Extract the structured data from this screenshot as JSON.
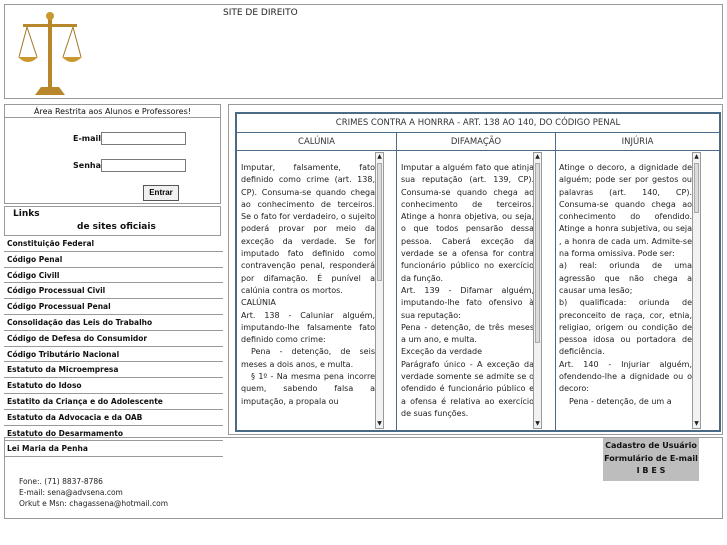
{
  "header": {
    "title": "SITE DE DIREITO"
  },
  "login": {
    "title": "Área Restrita aos Alunos e Professores!",
    "email_label": "E-mail",
    "password_label": "Senha",
    "submit_label": "Entrar"
  },
  "links": {
    "title": "Links",
    "subtitle": "de sites oficiais",
    "items": [
      "Constituição Federal",
      "Código Penal",
      "Código Civill",
      "Código Processual Civil",
      "Código Processual Penal",
      "Consolidação das Leis do Trabalho",
      "Código de Defesa do Consumidor",
      "Código Tributário Nacional",
      "Estatuto da Microempresa",
      "Estatuto do Idoso",
      "Estatito da Criança e do Adolescente",
      "Estatuto da Advocacia e da OAB",
      "Estatuto do Desarmamento",
      "Lei Maria da Penha"
    ]
  },
  "crimes": {
    "title": "CRIMES CONTRA A HONRRA - ART. 138 AO 140, DO CÓDIGO PENAL",
    "columns": [
      {
        "heading": "CALÚNIA",
        "paragraphs": [
          "Imputar, falsamente, fato definido como crime (art. 138, CP). Consuma-se quando chega ao conhecimento de terceiros. Se o fato for verdadeiro, o sujeito poderá provar por meio da exceção da verdade. Se for imputado fato definido como contravenção penal, responderá por difamação. É punível a calúnia contra os mortos.",
          "CALÚNIA",
          "Art. 138 - Caluniar alguém, imputando-lhe falsamente fato definido como crime:",
          "Pena - detenção, de seis meses a dois anos, e multa.",
          "§ 1º - Na mesma pena incorre quem, sabendo falsa a imputação, a propala ou"
        ]
      },
      {
        "heading": "DIFAMAÇÃO",
        "paragraphs": [
          "Imputar a alguém fato que atinja sua reputação (art. 139, CP). Consuma-se quando chega ao conhecimento de terceiros. Atinge a honra objetiva, ou seja, o que todos pensarão dessa pessoa. Caberá exceção da verdade se a ofensa for contra funcionário público no exercício da função.",
          "Art. 139 - Difamar alguém, imputando-lhe fato ofensivo à sua reputação:",
          "Pena - detenção, de três meses a um ano, e multa.",
          "Exceção da verdade",
          "Parágrafo único - A exceção da verdade somente se admite se o ofendido é funcionário público e a ofensa é relativa ao exercício de suas funções."
        ]
      },
      {
        "heading": "INJÚRIA",
        "paragraphs": [
          "Atinge o decoro, a dignidade de alguém; pode ser por gestos ou palavras (art. 140, CP). Consuma-se quando chega ao conhecimento do ofendido. Atinge a honra subjetiva, ou seja , a honra de cada um. Admite-se na forma omissiva. Pode ser:",
          "a) real: oriunda de uma agressão que não chega a causar uma lesão;",
          "b) qualificada: oriunda de preconceito de raça, cor, etnia, religiao, origem ou condição de pessoa idosa ou portadora de deficiência.",
          "Art. 140 - Injuriar alguém, ofendendo-lhe a dignidade ou o decoro:",
          "Pena - detenção, de um a"
        ]
      }
    ]
  },
  "footer": {
    "phone": "Fone:. (71) 8837-8786",
    "email": "E-mail: sena@advsena.com",
    "orkut": "Orkut e Msn: chagassena@hotmail.com",
    "cadastro": [
      "Cadastro de Usuário",
      "Formulário de E-mail",
      "I B E S"
    ]
  }
}
